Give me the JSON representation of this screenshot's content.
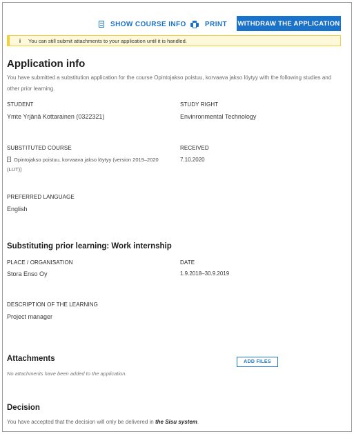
{
  "toolbar": {
    "show_course_info": "SHOW COURSE INFO",
    "print": "PRINT",
    "withdraw": "WITHDRAW THE APPLICATION"
  },
  "notice": {
    "text": "You can still submit attachments to your application until it is handled."
  },
  "application": {
    "title": "Application info",
    "intro": "You have submitted a substitution application for the course Opintojakso poistuu, korvaava jakso löytyy with the following studies and other prior learning.",
    "student_label": "STUDENT",
    "student_value": "Ymte Yrjänä Kottarainen (0322321)",
    "study_right_label": "STUDY RIGHT",
    "study_right_value": "Envinronmental Technology",
    "substituted_course_label": "SUBSTITUTED COURSE",
    "substituted_course_value": "Opintojakso poistuu, korvaava jakso löytyy (version 2019–2020 (LUT))",
    "received_label": "RECEIVED",
    "received_value": "7.10.2020",
    "language_label": "PREFERRED LANGUAGE",
    "language_value": "English"
  },
  "prior_learning": {
    "title": "Substituting prior learning: Work internship",
    "place_label": "PLACE / ORGANISATION",
    "place_value": "Stora Enso Oy",
    "date_label": "DATE",
    "date_value": "1.9.2018–30.9.2019",
    "description_label": "DESCRIPTION OF THE LEARNING",
    "description_value": "Project manager"
  },
  "attachments": {
    "title": "Attachments",
    "add_files": "ADD FILES",
    "empty_text": "No attachments have been added to the application."
  },
  "decision": {
    "title": "Decision",
    "text_before": "You have accepted that the decision will only be delivered in ",
    "system": "the Sisu system",
    "text_after": "."
  }
}
